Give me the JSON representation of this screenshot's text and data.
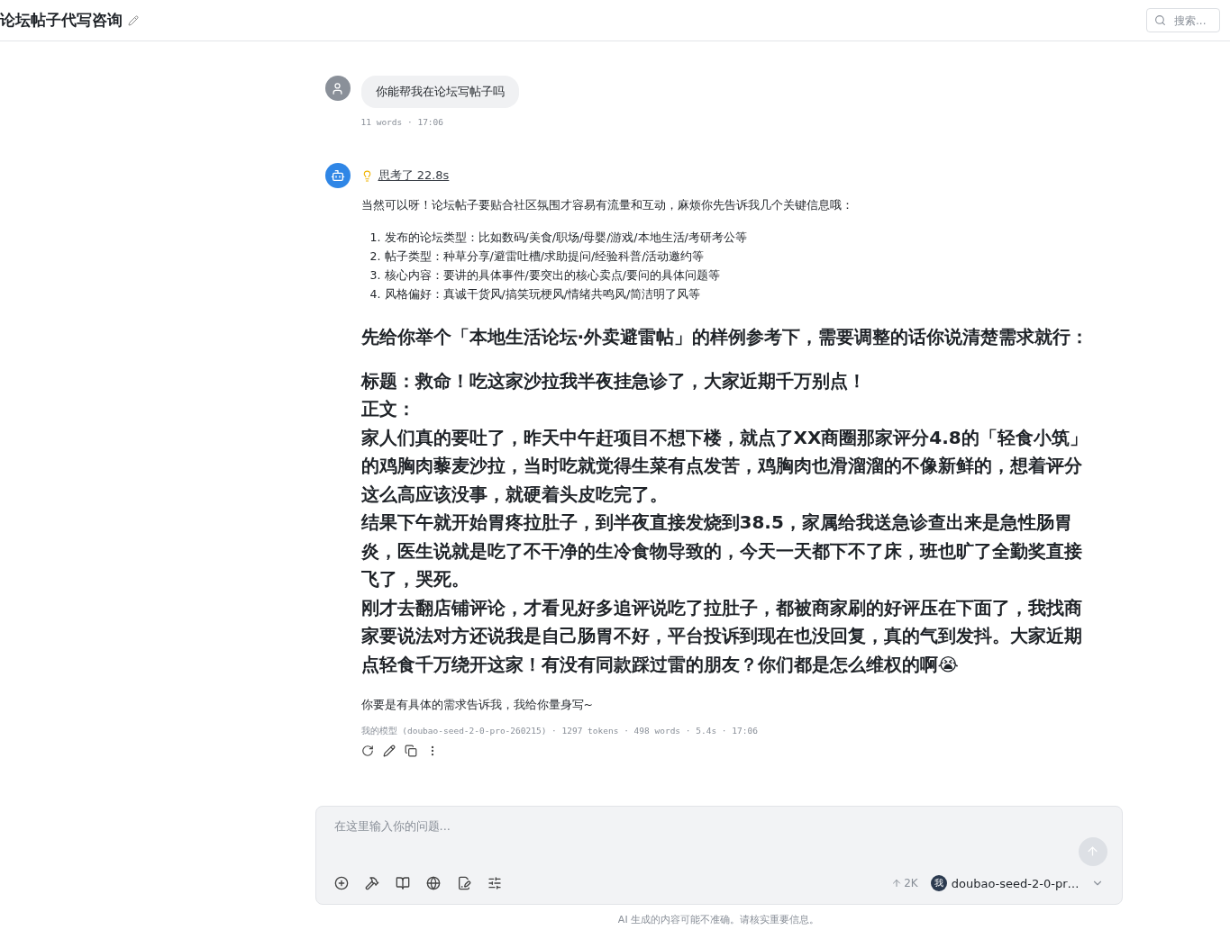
{
  "header": {
    "title": "论坛帖子代写咨询",
    "search": {
      "placeholder": "搜索..."
    }
  },
  "messages": [
    {
      "kind": "user",
      "text": "你能帮我在论坛写帖子吗",
      "meta": "11 words · 17:06"
    },
    {
      "kind": "assistant",
      "thinking": "思考了 22.8s",
      "intro": "当然可以呀！论坛帖子要贴合社区氛围才容易有流量和互动，麻烦你先告诉我几个关键信息哦：",
      "list": [
        {
          "number": "1.",
          "text": "发布的论坛类型：比如数码/美食/职场/母婴/游戏/本地生活/考研考公等"
        },
        {
          "number": "2.",
          "text": "帖子类型：种草分享/避雷吐槽/求助提问/经验科普/活动邀约等"
        },
        {
          "number": "3.",
          "text": "核心内容：要讲的具体事件/要突出的核心卖点/要问的具体问题等"
        },
        {
          "number": "4.",
          "text": "风格偏好：真诚干货风/搞笑玩梗风/情绪共鸣风/简洁明了风等"
        }
      ],
      "bold_blocks": [
        [
          "先给你举个「本地生活论坛·外卖避雷帖」的样例参考下，需要调整的话你说清楚需求就行："
        ],
        [
          "标题：救命！吃这家沙拉我半夜挂急诊了，大家近期千万别点！",
          "正文：",
          "家人们真的要吐了，昨天中午赶项目不想下楼，就点了XX商圈那家评分4.8的「轻食小筑」的鸡胸肉藜麦沙拉，当时吃就觉得生菜有点发苦，鸡胸肉也滑溜溜的不像新鲜的，想着评分这么高应该没事，就硬着头皮吃完了。",
          "结果下午就开始胃疼拉肚子，到半夜直接发烧到38.5，家属给我送急诊查出来是急性肠胃炎，医生说就是吃了不干净的生冷食物导致的，今天一天都下不了床，班也旷了全勤奖直接飞了，哭死。",
          "刚才去翻店铺评论，才看见好多追评说吃了拉肚子，都被商家刷的好评压在下面了，我找商家要说法对方还说我是自己肠胃不好，平台投诉到现在也没回复，真的气到发抖。大家近期点轻食千万绕开这家！有没有同款踩过雷的朋友？你们都是怎么维权的啊😭"
        ]
      ],
      "outro": "你要是有具体的需求告诉我，我给你量身写~",
      "meta": "我的模型 (doubao-seed-2-0-pro-260215) · 1297 tokens · 498 words · 5.4s · 17:06"
    }
  ],
  "composer": {
    "placeholder": "在这里输入你的问题...",
    "send": {
      "disabled": true
    },
    "tokens": "2K",
    "model_badge": "我",
    "model": "doubao-seed-2-0-pr…"
  },
  "disclaimer": "AI 生成的内容可能不准确。请核实重要信息。"
}
